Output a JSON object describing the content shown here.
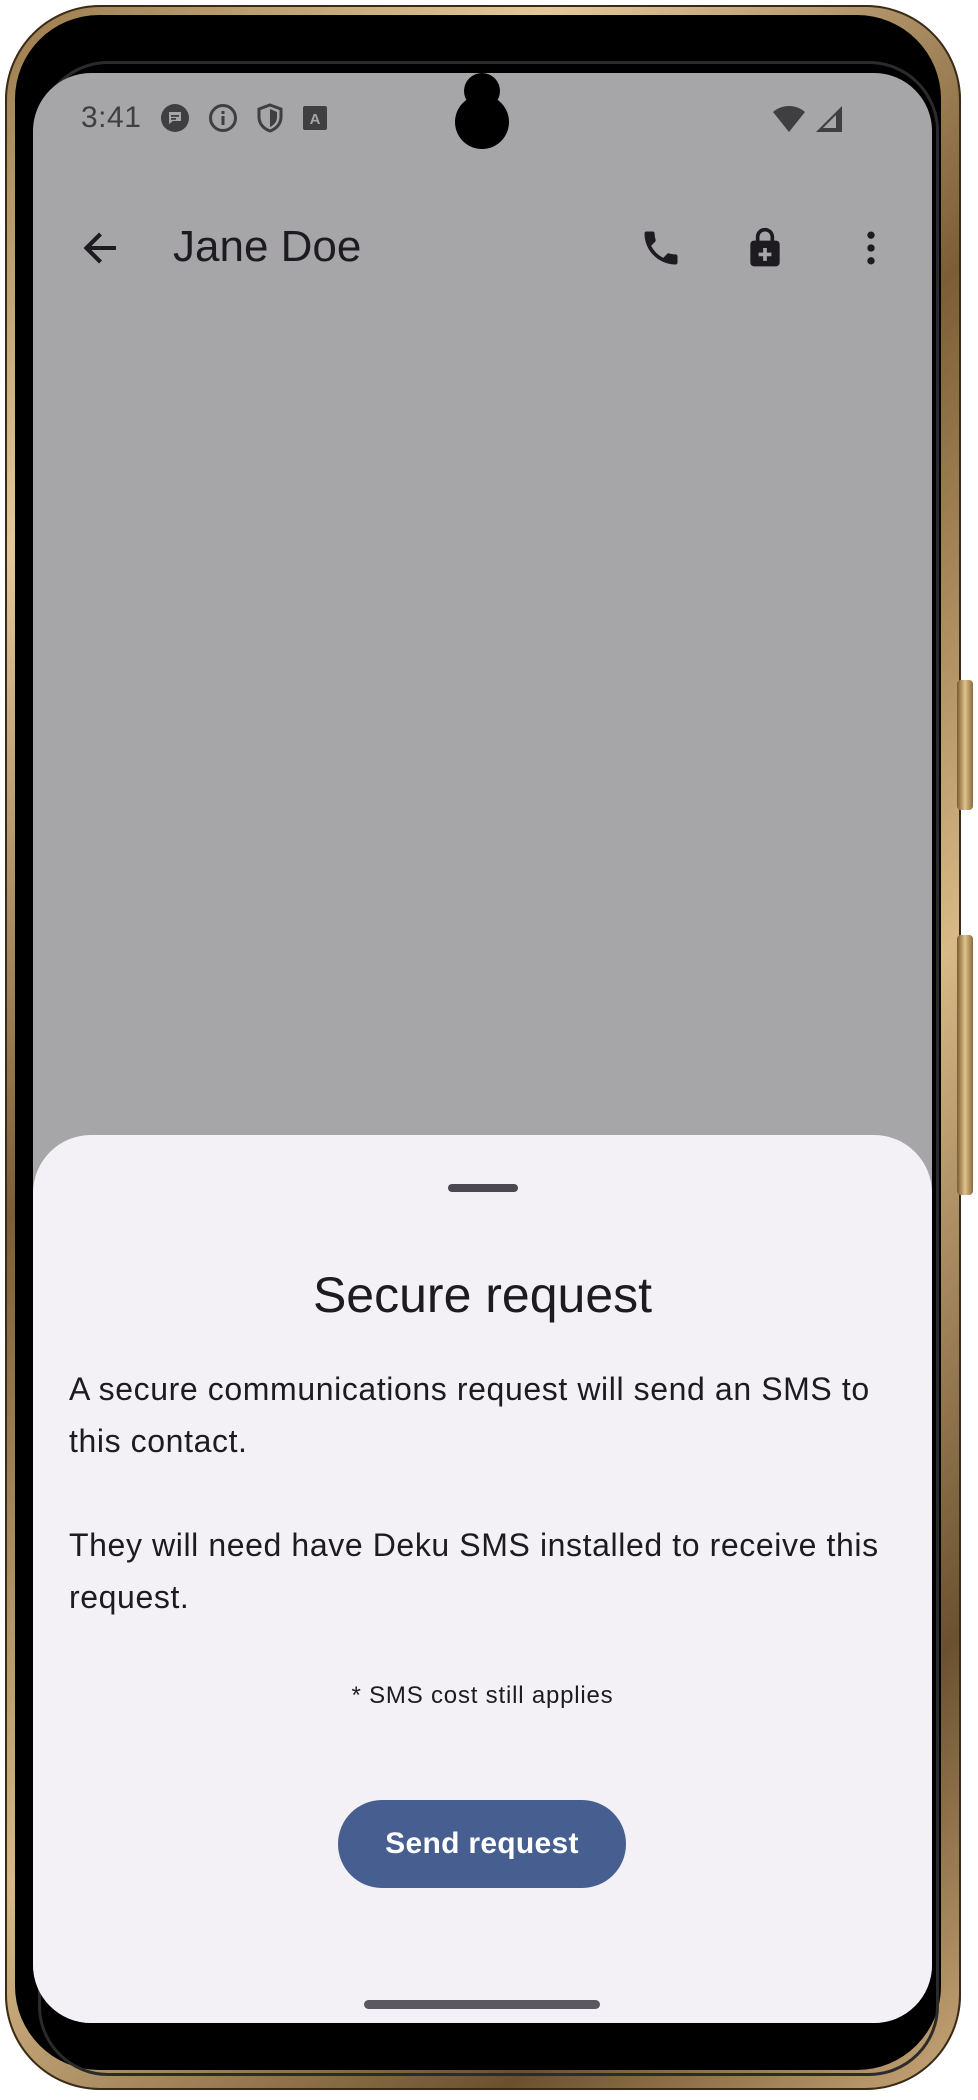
{
  "status_bar": {
    "time": "3:41",
    "left_icons": [
      "messages-icon",
      "info-icon",
      "shield-icon",
      "text-a-icon"
    ],
    "right_icons": [
      "wifi-icon",
      "cell-signal-icon"
    ]
  },
  "app_bar": {
    "contact_name": "Jane Doe",
    "actions": [
      "back-arrow-icon",
      "phone-icon",
      "lock-add-icon",
      "more-vert-icon"
    ]
  },
  "sheet": {
    "title": "Secure request",
    "paragraph_1": "A secure communications request will send an SMS to this contact.",
    "paragraph_2": "They will need have Deku SMS installed to receive this request.",
    "note": "* SMS cost still applies",
    "button_label": "Send request"
  },
  "colors": {
    "scrim": "#a6a6a8",
    "sheet_bg": "#f3f0f6",
    "button_bg": "#475e91",
    "text": "#1d1b20",
    "frame_gold": "#c9a878"
  }
}
